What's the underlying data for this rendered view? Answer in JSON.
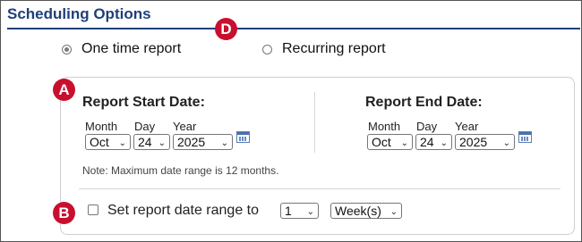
{
  "section": {
    "title": "Scheduling Options"
  },
  "report_type": {
    "options": [
      {
        "label": "One time report",
        "selected": true
      },
      {
        "label": "Recurring report",
        "selected": false
      }
    ]
  },
  "start": {
    "title": "Report Start Date:",
    "labels": {
      "month": "Month",
      "day": "Day",
      "year": "Year"
    },
    "month": "Oct",
    "day": "24",
    "year": "2025"
  },
  "end": {
    "title": "Report End Date:",
    "labels": {
      "month": "Month",
      "day": "Day",
      "year": "Year"
    },
    "month": "Oct",
    "day": "24",
    "year": "2025"
  },
  "note": "Note: Maximum date range is 12 months.",
  "range": {
    "label": "Set report date range to",
    "count": "1",
    "unit": "Week(s)",
    "checked": false
  },
  "badges": {
    "a": "A",
    "b": "B",
    "d": "D"
  },
  "colors": {
    "title": "#1f3f7a",
    "badge": "#c8102e"
  }
}
